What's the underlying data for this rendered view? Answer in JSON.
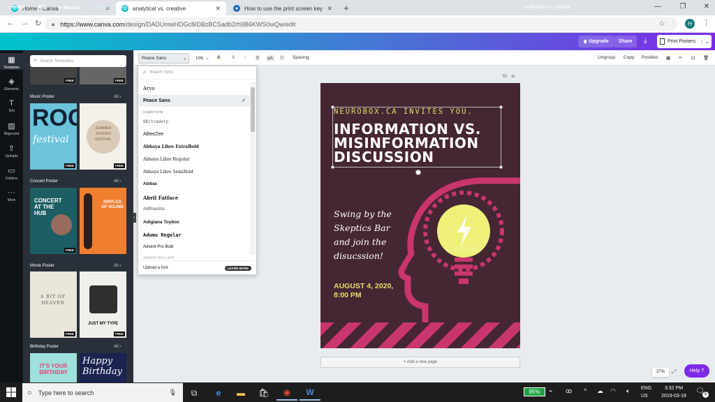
{
  "browser": {
    "tabs": [
      {
        "title": "Home - Canva",
        "favicon": "canva-icon",
        "active": false
      },
      {
        "title": "analytical vs. creative",
        "favicon": "canva-icon",
        "active": true
      },
      {
        "title": "How to use the print screen key (",
        "favicon": "webpage-icon",
        "active": false
      }
    ],
    "url_domain": "https://www.canva.com",
    "url_path": "/design/DADUmwHDGc8/DBzBCSadb2rh9B6KWS0wQw/edit",
    "profile_initial": "H"
  },
  "header": {
    "home": "Home",
    "file": "File",
    "resize": "Resize",
    "saved": "All changes saved",
    "design_title": "analytical vs. creative",
    "upgrade": "Upgrade",
    "share": "Share",
    "print": "Print Posters"
  },
  "rail": [
    "Templates",
    "Elements",
    "Text",
    "Bkground",
    "Uploads",
    "Folders",
    "More"
  ],
  "templates": {
    "search_placeholder": "Search Templates",
    "sections": [
      {
        "title": "Music Poster",
        "all": "All"
      },
      {
        "title": "Concert Poster",
        "all": "All"
      },
      {
        "title": "Movie Poster",
        "all": "All"
      },
      {
        "title": "Birthday Poster",
        "all": "All"
      }
    ],
    "free": "FREE",
    "thumbs": {
      "t0a": "ROCK",
      "t0a2": "festival",
      "t0b": "SUMMER SOUNDS FESTIVAL",
      "t1a": "CONCERT AT THE HUB",
      "t1b": "RIPPLES OF SOUND",
      "t2a": "A BIT OF HEAVEN",
      "t2b": "JUST MY TYPE",
      "t3a": "IT'S YOUR BIRTHDAY",
      "t3b": "Happy Birthday"
    }
  },
  "toolbar": {
    "font": "Peace Sans",
    "size": "106",
    "spacing": "Spacing",
    "ungroup": "Ungroup",
    "copy": "Copy",
    "position": "Position"
  },
  "font_dropdown": {
    "search_placeholder": "Search fonts",
    "top_fonts": [
      "Arvo",
      "Peace Sans"
    ],
    "section_label": "English fonts",
    "fonts": [
      "8Bitcadetp",
      "ABeeZee",
      "Abhaya Libre ExtraBold",
      "Abhaya Libre Regular",
      "Abhaya Libre SemiBold",
      "Abibas",
      "Abril Fatface",
      "AdBhashita",
      "Adigiana Toybox",
      "Adumu Regular",
      "Advent Pro Bold",
      "Advent Pro Light"
    ],
    "upload": "Upload a font",
    "learn_more": "LEARN MORE"
  },
  "poster": {
    "invite": "NEUROBOX.CA INVITES YOU.",
    "headline": [
      "INFORMATION VS.",
      "MISINFORMATION",
      "DISCUSSION"
    ],
    "body": [
      "Swing by the",
      "Skeptics Bar",
      "and join the",
      "disucssion!"
    ],
    "date": "AUGUST 4, 2020,",
    "time": "8:00 PM",
    "watermark": "Canva",
    "colors": {
      "bg": "#452633",
      "accent": "#c9356e",
      "yellow": "#e8df6b",
      "bulb": "#eef07a"
    }
  },
  "canvas": {
    "add_page": "+ Add a new page",
    "zoom": "37%",
    "help": "Help ?"
  },
  "taskbar": {
    "search": "Type here to search",
    "battery": "95%",
    "lang1": "ENG",
    "lang2": "US",
    "time": "3:32 PM",
    "date": "2019-03-18",
    "notifications": "5"
  }
}
